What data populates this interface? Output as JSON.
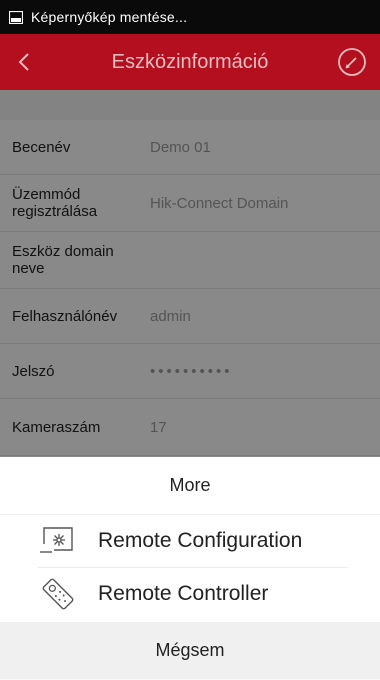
{
  "status_bar": {
    "icon": "image-icon",
    "text": "Képernyőkép mentése..."
  },
  "app_bar": {
    "title": "Eszközinformáció",
    "back_icon": "chevron-left-icon",
    "edit_icon": "pencil-icon",
    "color": "#b30f1f"
  },
  "device_info": {
    "rows": [
      {
        "label": "Becenév",
        "value": "Demo 01"
      },
      {
        "label": "Üzemmód regisztrálása",
        "value": "Hik-Connect Domain"
      },
      {
        "label": "Eszköz domain neve",
        "value": ""
      },
      {
        "label": "Felhasználónév",
        "value": "admin"
      },
      {
        "label": "Jelszó",
        "value": "••••••••••"
      },
      {
        "label": "Kameraszám",
        "value": "17"
      }
    ]
  },
  "sheet": {
    "header": "More",
    "items": [
      {
        "label": "Remote Configuration",
        "icon": "remote-configuration-icon"
      },
      {
        "label": "Remote Controller",
        "icon": "remote-controller-icon"
      }
    ],
    "cancel": "Mégsem"
  }
}
